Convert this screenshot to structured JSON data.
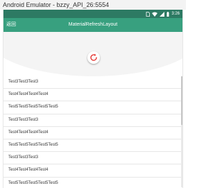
{
  "window": {
    "title": "Android Emulator - bzzy_API_26:5554"
  },
  "statusbar": {
    "time": "3:26"
  },
  "appbar": {
    "back_label": "返回",
    "title": "MaterialRefreshLayout"
  },
  "colors": {
    "accent": "#38a07f",
    "statusbar": "#2d7a63",
    "spinner": "#e53935"
  },
  "list": {
    "items": [
      "Test3Test3Test3",
      "Test4Test4Test4Test4",
      "Test5Test5Test5Test5Test5",
      "Test3Test3Test3",
      "Test4Test4Test4Test4",
      "Test5Test5Test5Test5Test5",
      "Test3Test3Test3",
      "Test4Test4Test4Test4",
      "Test5Test5Test5Test5Test5"
    ]
  }
}
